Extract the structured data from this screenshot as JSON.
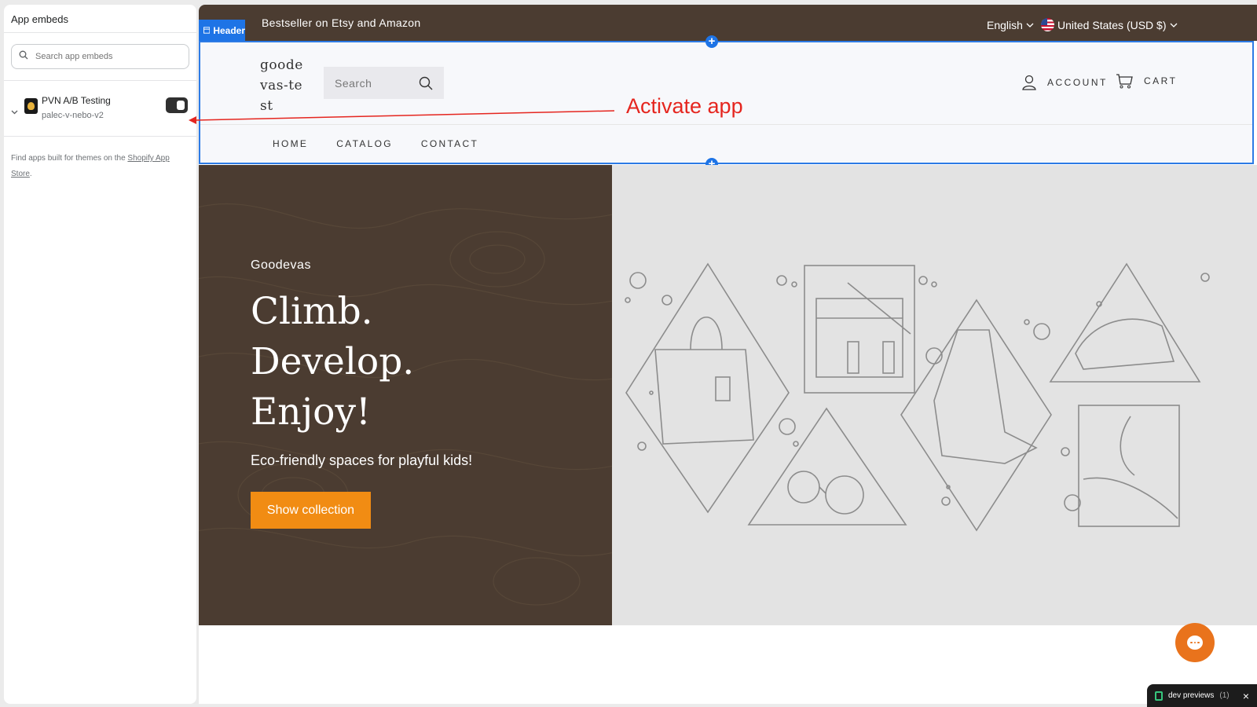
{
  "sidebar": {
    "title": "App embeds",
    "search_placeholder": "Search app embeds",
    "app": {
      "name": "PVN A/B Testing",
      "handle": "palec-v-nebo-v2",
      "enabled": true
    },
    "note_prefix": "Find apps built for themes on the ",
    "note_link": "Shopify App Store",
    "note_suffix": "."
  },
  "storefront": {
    "announcement": "Bestseller on Etsy and Amazon",
    "language": "English",
    "country": "United States (USD $)",
    "section_badge": "Header",
    "logo_lines": [
      "goode",
      "vas-te",
      "st"
    ],
    "search_placeholder": "Search",
    "account_label": "ACCOUNT",
    "cart_label": "CART",
    "nav": [
      "HOME",
      "CATALOG",
      "CONTACT"
    ],
    "hero": {
      "subheading": "Goodevas",
      "title_lines": [
        "Climb.",
        "Develop.",
        "Enjoy!"
      ],
      "description": "Eco-friendly spaces for playful kids!",
      "button": "Show collection"
    }
  },
  "annotation": "Activate app",
  "dev_previews": "dev previews",
  "dev_previews_count": "(1)",
  "colors": {
    "brown": "#4b3c31",
    "accent_blue": "#1e74e6",
    "orange": "#f18c13",
    "annotation_red": "#e5261f"
  }
}
